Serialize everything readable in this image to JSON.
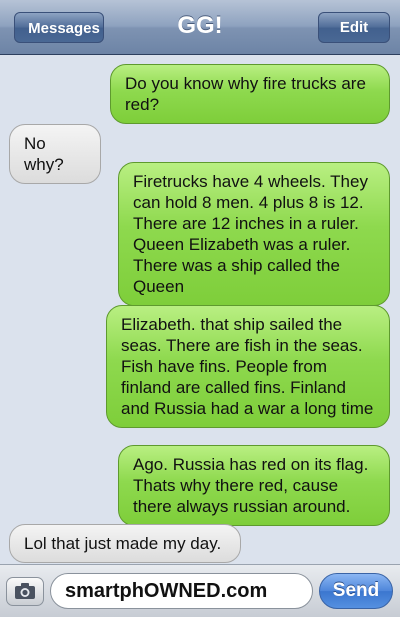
{
  "header": {
    "back_label": "Messages",
    "title": "GG!",
    "edit_label": "Edit"
  },
  "messages": [
    {
      "side": "sent",
      "text": "Do you know why fire trucks are red?"
    },
    {
      "side": "received",
      "text": "No why?"
    },
    {
      "side": "sent",
      "text": "Firetrucks have 4 wheels. They can hold 8 men. 4 plus 8 is 12. There are 12 inches in a ruler. Queen Elizabeth was a ruler. There was a ship called the Queen"
    },
    {
      "side": "sent",
      "text": "Elizabeth. that ship sailed the seas. There are fish in the seas. Fish have fins. People from finland are called fins. Finland and Russia had a war a long time"
    },
    {
      "side": "sent",
      "text": "Ago. Russia has red on its flag. Thats why there red, cause there always russian around."
    },
    {
      "side": "received",
      "text": "Lol that just made my day."
    }
  ],
  "composer": {
    "camera_icon": "camera-icon",
    "input_value": "smartphOWNED.com",
    "send_label": "Send"
  },
  "colors": {
    "sent_bubble": "#8ed94e",
    "received_bubble": "#e4e4e4",
    "nav_bar": "#8ea2bf",
    "send_button": "#4e86da"
  }
}
